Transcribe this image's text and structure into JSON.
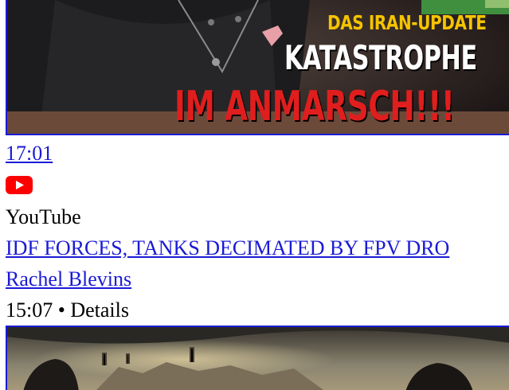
{
  "video1": {
    "overlay_line1": "DAS IRAN-UPDATE",
    "overlay_line2": "KATASTROPHE",
    "overlay_line3": "IM ANMARSCH!!!",
    "duration": "17:01",
    "source_icon": "youtube-icon",
    "source": "YouTube"
  },
  "video2": {
    "title": "IDF FORCES, TANKS DECIMATED BY FPV DRO",
    "channel": "Rachel Blevins",
    "meta": "15:07 • Details"
  },
  "colors": {
    "link": "#1a1ad6",
    "youtube_red": "#ff0000",
    "overlay_yellow": "#f5c400",
    "overlay_red": "#e01e1e"
  }
}
